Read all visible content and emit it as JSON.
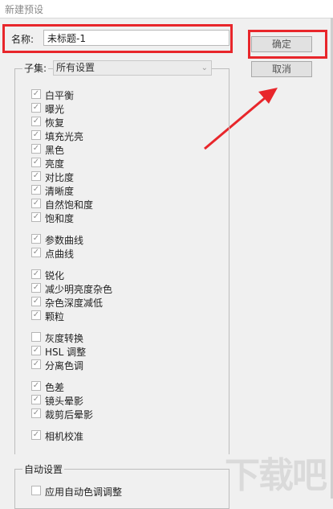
{
  "window": {
    "title": "新建预设"
  },
  "name_field": {
    "label": "名称:",
    "value": "未标题-1"
  },
  "buttons": {
    "ok": "确定",
    "cancel": "取消"
  },
  "subset": {
    "label": "子集:",
    "selected": "所有设置"
  },
  "items": [
    {
      "label": "白平衡",
      "checked": true
    },
    {
      "label": "曝光",
      "checked": true
    },
    {
      "label": "恢复",
      "checked": true
    },
    {
      "label": "填充光亮",
      "checked": true
    },
    {
      "label": "黑色",
      "checked": true
    },
    {
      "label": "亮度",
      "checked": true
    },
    {
      "label": "对比度",
      "checked": true
    },
    {
      "label": "清晰度",
      "checked": true
    },
    {
      "label": "自然饱和度",
      "checked": true
    },
    {
      "label": "饱和度",
      "checked": true
    },
    {
      "label": "参数曲线",
      "checked": true
    },
    {
      "label": "点曲线",
      "checked": true
    },
    {
      "label": "锐化",
      "checked": true
    },
    {
      "label": "减少明亮度杂色",
      "checked": true
    },
    {
      "label": "杂色深度减低",
      "checked": true
    },
    {
      "label": "颗粒",
      "checked": true
    },
    {
      "label": "灰度转换",
      "checked": false
    },
    {
      "label": "HSL 调整",
      "checked": true
    },
    {
      "label": "分离色调",
      "checked": true
    },
    {
      "label": "色差",
      "checked": true
    },
    {
      "label": "镜头晕影",
      "checked": true
    },
    {
      "label": "裁剪后晕影",
      "checked": true
    },
    {
      "label": "相机校准",
      "checked": true
    }
  ],
  "auto_settings": {
    "label": "自动设置",
    "items": [
      {
        "label": "应用自动色调调整",
        "checked": false
      }
    ]
  },
  "watermark": "下载吧",
  "colors": {
    "annotation_red": "#e8262b",
    "background": "#f0f0f0"
  }
}
